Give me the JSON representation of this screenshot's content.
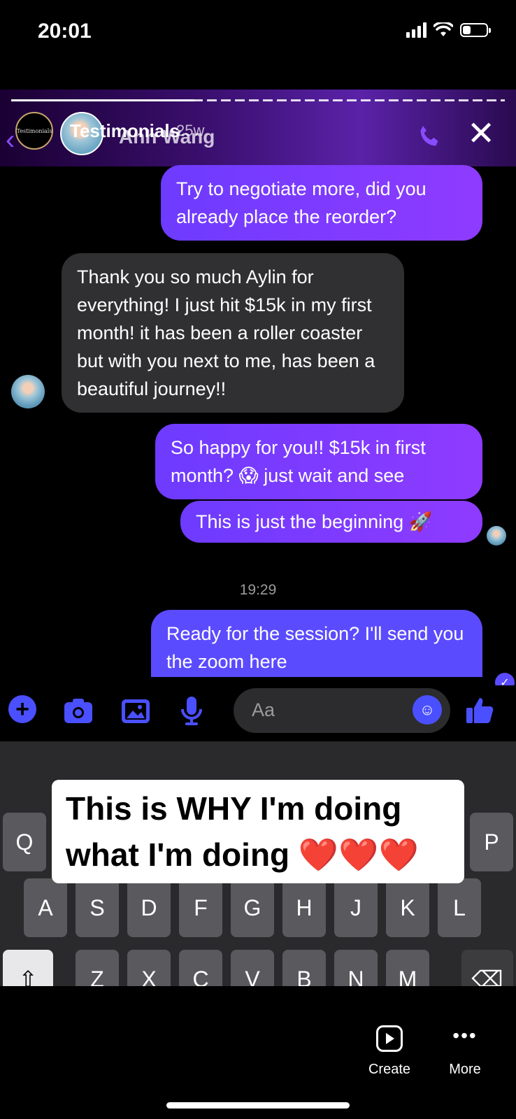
{
  "status_bar": {
    "time": "20:01"
  },
  "story_header": {
    "account_badge": "Testimonials",
    "title": "Testimonials",
    "contact_name": "Anh Wang",
    "age": "25w"
  },
  "chat": {
    "messages": [
      {
        "from": "me",
        "text": "Try to negotiate more, did you already place the reorder?"
      },
      {
        "from": "them",
        "text": "Thank you so much Aylin for everything! I just hit $15k in my first month! it has been a roller coaster but with you next to me, has been a beautiful journey!!"
      },
      {
        "from": "me",
        "text": "So happy for you!! $15k in first month? 😱 just wait and see"
      },
      {
        "from": "me",
        "text": "This is just the beginning 🚀"
      },
      {
        "from": "me",
        "text": "Ready for the session? I'll send you the zoom here"
      }
    ],
    "timestamp": "19:29"
  },
  "composer": {
    "placeholder": "Aa"
  },
  "caption": {
    "line1": "This is WHY I'm doing",
    "line2": "what I'm doing ❤️❤️❤️"
  },
  "keyboard": {
    "row1_visible": [
      "Q",
      "P"
    ],
    "row2": [
      "A",
      "S",
      "D",
      "F",
      "G",
      "H",
      "J",
      "K",
      "L"
    ],
    "row3": [
      "Z",
      "X",
      "C",
      "V",
      "B",
      "N",
      "M"
    ]
  },
  "bottom_bar": {
    "create_label": "Create",
    "more_label": "More"
  },
  "colors": {
    "accent": "#5b4bff",
    "outgoing_gradient": "#8e3bff",
    "incoming": "#303032"
  }
}
